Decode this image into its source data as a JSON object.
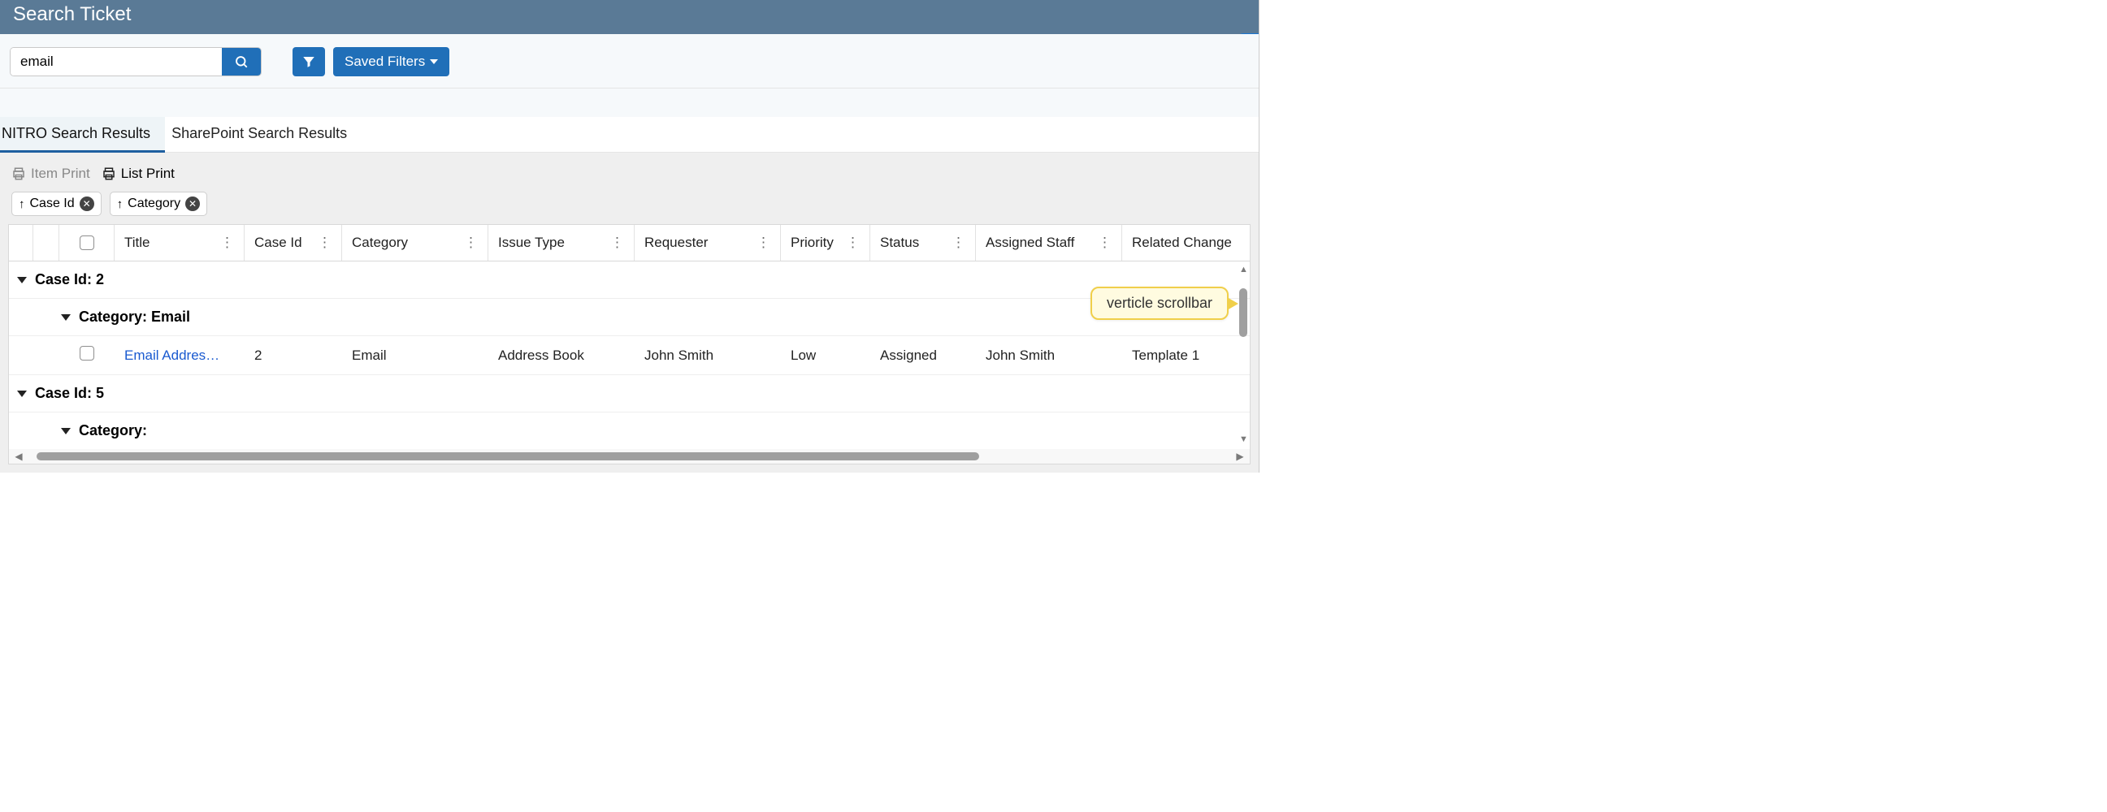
{
  "header": {
    "title": "Search Ticket"
  },
  "toolbar": {
    "search_value": "email",
    "saved_filters_label": "Saved Filters"
  },
  "tabs": [
    {
      "label": "NITRO Search Results",
      "active": true
    },
    {
      "label": "SharePoint Search Results",
      "active": false
    }
  ],
  "print_bar": {
    "item_print": "Item Print",
    "list_print": "List Print"
  },
  "sort_chips": [
    {
      "label": "Case Id"
    },
    {
      "label": "Category"
    }
  ],
  "columns": [
    {
      "label": "Title"
    },
    {
      "label": "Case Id"
    },
    {
      "label": "Category"
    },
    {
      "label": "Issue Type"
    },
    {
      "label": "Requester"
    },
    {
      "label": "Priority"
    },
    {
      "label": "Status"
    },
    {
      "label": "Assigned Staff"
    },
    {
      "label": "Related Change"
    }
  ],
  "groups": [
    {
      "label": "Case Id: 2",
      "subgroups": [
        {
          "label": "Category: Email",
          "rows": [
            {
              "title": "Email Addres…",
              "case_id": "2",
              "category": "Email",
              "issue_type": "Address Book",
              "requester": "John Smith",
              "priority": "Low",
              "status": "Assigned",
              "assigned_staff": "John Smith",
              "related_change": "Template 1"
            }
          ]
        }
      ]
    },
    {
      "label": "Case Id: 5",
      "subgroups": [
        {
          "label": "Category:"
        }
      ]
    }
  ],
  "callout": {
    "text": "verticle scrollbar"
  }
}
